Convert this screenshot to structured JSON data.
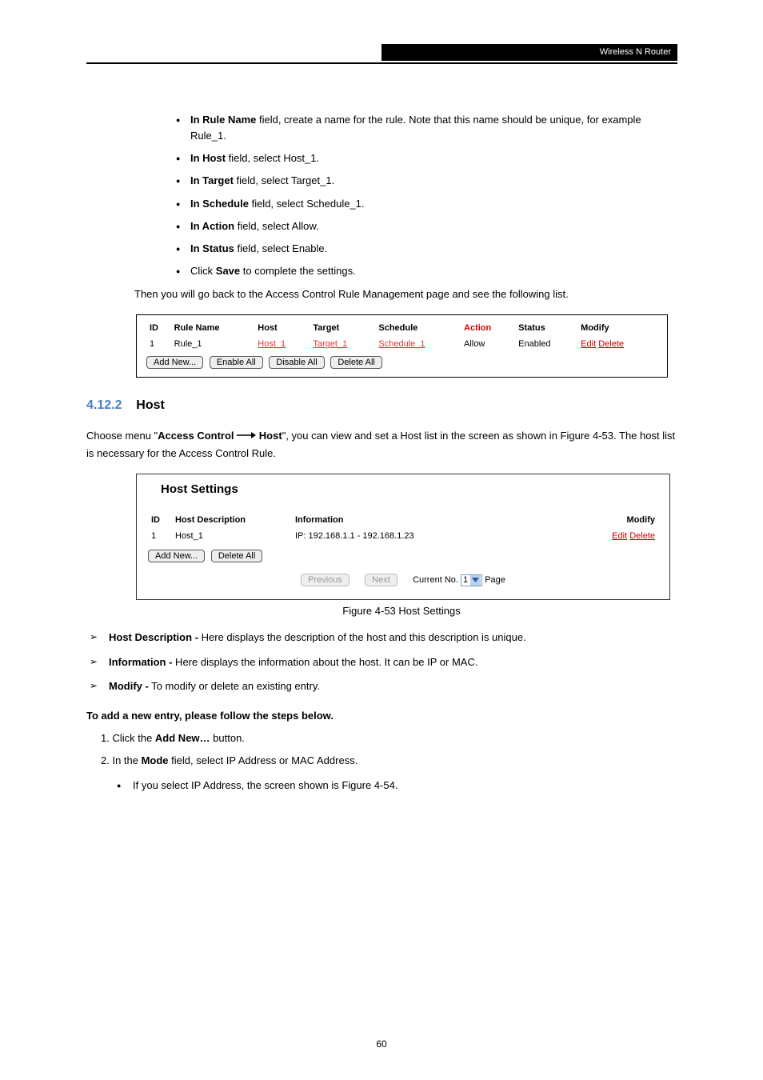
{
  "header_bar": "Wireless N Router",
  "page_number": "60",
  "numbered_steps": [
    {
      "label": "In Rule Name",
      "tail": " field, create a name for the rule. Note that this name should be unique, for example Rule_1."
    },
    {
      "label": "In Host",
      "tail": " field, select Host_1."
    },
    {
      "label": "In Target",
      "tail": " field, select Target_1."
    },
    {
      "label": "In Schedule",
      "tail": " field, select Schedule_1."
    },
    {
      "label": "In Action",
      "tail": " field, select Allow."
    },
    {
      "label": "In Status",
      "tail": " field, select Enable."
    },
    {
      "label": "Click ",
      "bold_tail": "Save",
      "tail2": " to complete the settings."
    }
  ],
  "then_line": "Then you will go back to the Access Control Rule Management page and see the following list.",
  "fig1": {
    "headers": [
      "ID",
      "Rule Name",
      "Host",
      "Target",
      "Schedule",
      "Action",
      "Status",
      "Modify"
    ],
    "row": {
      "id": "1",
      "rule_name": "Rule_1",
      "host": "Host_1",
      "target": "Target_1",
      "schedule": "Schedule_1",
      "action": "Allow",
      "status": "Enabled",
      "edit": "Edit",
      "delete": "Delete"
    },
    "buttons": [
      "Add New...",
      "Enable All",
      "Disable All",
      "Delete All"
    ]
  },
  "section_heading": {
    "num": "4.12.2",
    "title": "Host"
  },
  "section_intro_1": "Choose menu \"",
  "section_intro_bold1": "Access Control",
  "section_intro_bold2": " Host",
  "section_intro_2": "\", you can view and set a Host list in the screen as shown in Figure 4-53. The host list is necessary for the Access Control Rule.",
  "fig2": {
    "title": "Host Settings",
    "headers": [
      "ID",
      "Host Description",
      "Information",
      "Modify"
    ],
    "row": {
      "id": "1",
      "desc": "Host_1",
      "info": "IP: 192.168.1.1 - 192.168.1.23",
      "edit": "Edit",
      "delete": "Delete"
    },
    "buttons": [
      "Add New...",
      "Delete All"
    ],
    "prev": "Previous",
    "next": "Next",
    "current_label": "Current No.",
    "page_value": "1",
    "page_label": "Page"
  },
  "fig2_caption": "Figure 4-53 Host Settings",
  "arrow_items": [
    {
      "bold": "Host Description -",
      "tail": " Here displays the description of the host and this description is unique."
    },
    {
      "bold": "Information -",
      "tail": " Here displays the information about the host. It can be IP or MAC."
    },
    {
      "bold": "Modify -",
      "tail": " To modify or delete an existing entry."
    }
  ],
  "add_entry": {
    "line1": "To add a new entry, please follow the steps below.",
    "step1_a": "1. Click the ",
    "step1_b": "Add New…",
    "step1_c": " button.",
    "step2_a": "2. In the ",
    "step2_b": "Mode",
    "step2_c": " field, select IP Address or MAC Address.",
    "sub_bullet_a": "If you select IP Address, the screen shown is Figure 4-54."
  }
}
